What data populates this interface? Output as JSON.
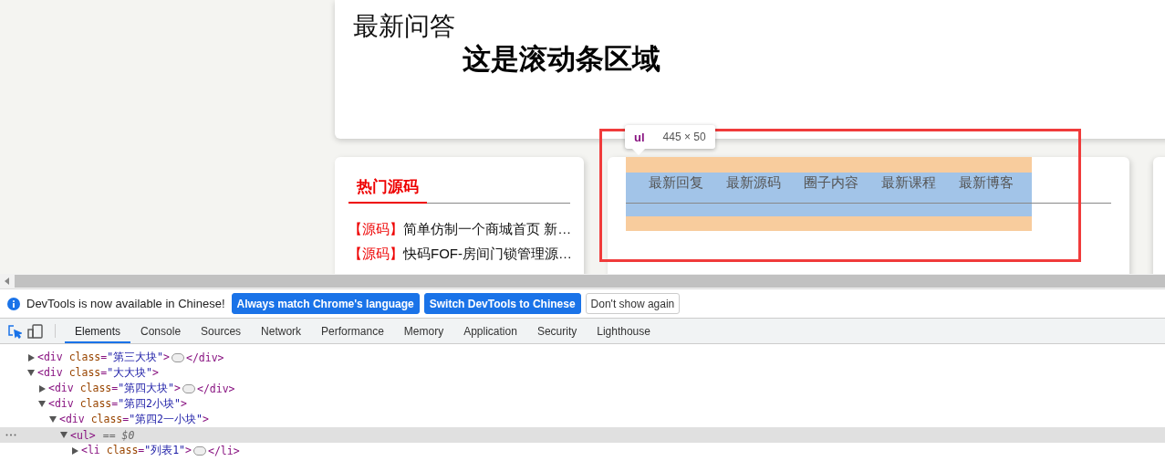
{
  "page": {
    "heading": "最新问答",
    "scroll_title": "这是滚动条区域",
    "hot_source": {
      "title": "热门源码",
      "items": [
        {
          "tag": "【源码】",
          "text": "简单仿制一个商城首页 新…"
        },
        {
          "tag": "【源码】",
          "text": "快码FOF-房间门锁管理源…"
        }
      ]
    },
    "nav": {
      "items": [
        "最新回复",
        "最新源码",
        "圈子内容",
        "最新课程",
        "最新博客"
      ]
    },
    "inspector_tooltip": {
      "tag": "ul",
      "size": "445 × 50"
    }
  },
  "devtools": {
    "infobar": {
      "message": "DevTools is now available in Chinese!",
      "buttons": [
        {
          "label": "Always match Chrome's language",
          "kind": "primary"
        },
        {
          "label": "Switch DevTools to Chinese",
          "kind": "primary"
        },
        {
          "label": "Don't show again",
          "kind": "secondary"
        }
      ]
    },
    "tabs": [
      {
        "label": "Elements",
        "selected": true
      },
      {
        "label": "Console",
        "selected": false
      },
      {
        "label": "Sources",
        "selected": false
      },
      {
        "label": "Network",
        "selected": false
      },
      {
        "label": "Performance",
        "selected": false
      },
      {
        "label": "Memory",
        "selected": false
      },
      {
        "label": "Application",
        "selected": false
      },
      {
        "label": "Security",
        "selected": false
      },
      {
        "label": "Lighthouse",
        "selected": false
      }
    ],
    "tree": [
      {
        "open": "<div class=\"第三大块\">",
        "close": "</div>",
        "expanded": false,
        "selected": false
      },
      {
        "open": "<div class=\"大大块\">",
        "expanded": true,
        "selected": false,
        "children": [
          {
            "open": "<div class=\"第四大块\">",
            "close": "</div>",
            "expanded": false,
            "selected": false
          },
          {
            "open": "<div class=\"第四2小块\">",
            "expanded": true,
            "selected": false,
            "children": [
              {
                "open": "<div class=\"第四2一小块\">",
                "expanded": true,
                "selected": false,
                "children": [
                  {
                    "open": "<ul>",
                    "suffix": "== $0",
                    "expanded": true,
                    "selected": true,
                    "children": [
                      {
                        "open": "<li class=\"列表1\">",
                        "close": "</li>",
                        "expanded": false,
                        "selected": false
                      }
                    ]
                  }
                ]
              }
            ]
          }
        ]
      }
    ]
  }
}
